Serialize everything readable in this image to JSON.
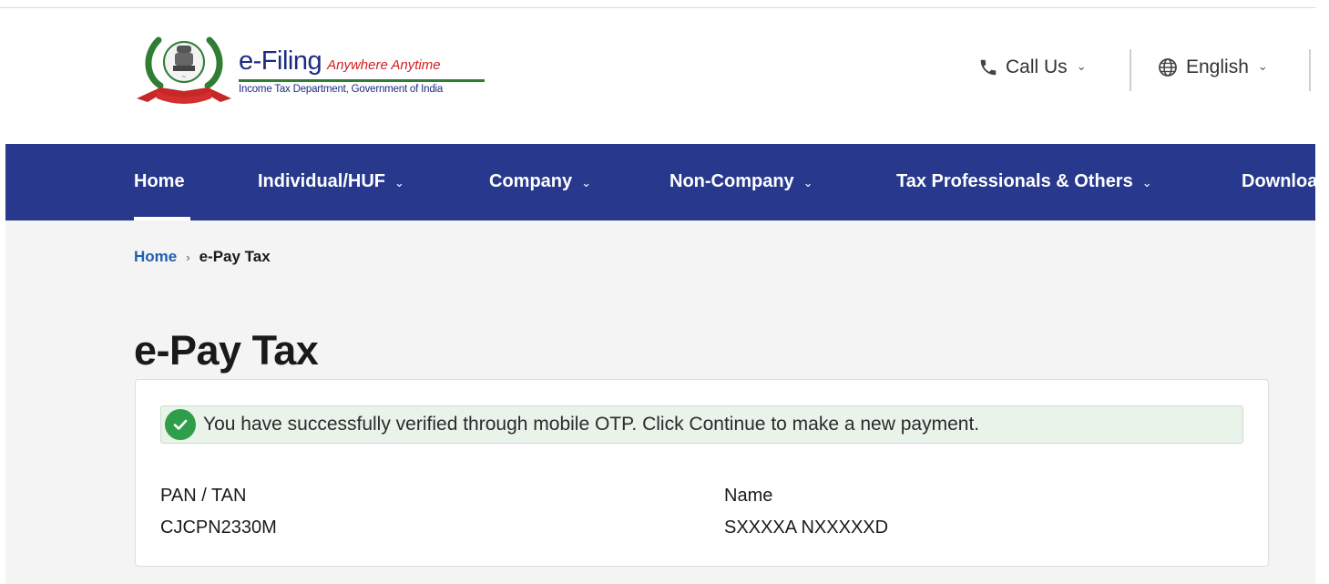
{
  "header": {
    "logo": {
      "title": "e-Filing",
      "tagline": "Anywhere Anytime",
      "department": "Income Tax Department, Government of India"
    },
    "call_us_label": "Call Us",
    "language_label": "English"
  },
  "nav": {
    "items": [
      {
        "label": "Home"
      },
      {
        "label": "Individual/HUF"
      },
      {
        "label": "Company"
      },
      {
        "label": "Non-Company"
      },
      {
        "label": "Tax Professionals & Others"
      },
      {
        "label": "Downloa"
      }
    ],
    "active_index": 0
  },
  "breadcrumb": {
    "home": "Home",
    "current": "e-Pay Tax"
  },
  "page": {
    "title": "e-Pay Tax"
  },
  "alert": {
    "type": "success",
    "message": "You have successfully verified through mobile OTP. Click Continue to make a new payment."
  },
  "details": {
    "pan_label": "PAN / TAN",
    "pan_value": "CJCPN2330M",
    "name_label": "Name",
    "name_value": "SXXXXA NXXXXXD"
  },
  "colors": {
    "nav_bg": "#28388c",
    "link": "#1f5fb0",
    "success": "#2e9e4b",
    "alert_bg": "#e9f3ea"
  }
}
